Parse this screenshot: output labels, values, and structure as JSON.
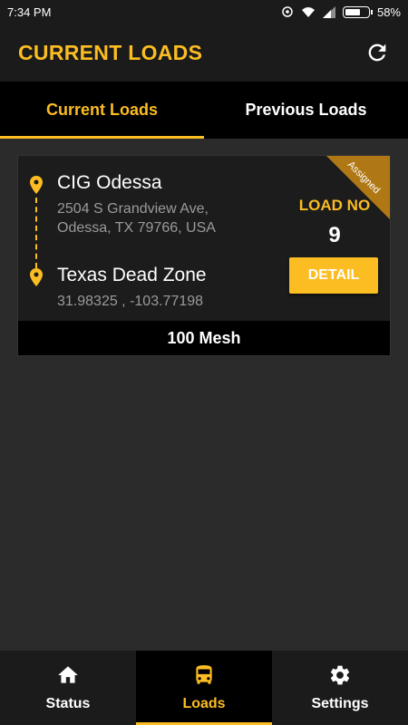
{
  "status_bar": {
    "time": "7:34 PM",
    "battery": "58%"
  },
  "header": {
    "title": "CURRENT LOADS",
    "refresh_icon": "refresh-icon"
  },
  "tabs": [
    {
      "label": "Current Loads",
      "active": true
    },
    {
      "label": "Previous Loads",
      "active": false
    }
  ],
  "load_card": {
    "ribbon": "Assigned",
    "origin": {
      "name": "CIG Odessa",
      "address_line1": "2504 S Grandview Ave,",
      "address_line2": "Odessa, TX 79766, USA"
    },
    "destination": {
      "name": "Texas Dead Zone",
      "coordinates": "31.98325 , -103.77198"
    },
    "load_no_label": "LOAD NO",
    "load_no": "9",
    "detail_label": "DETAIL",
    "product": "100 Mesh"
  },
  "bottom_nav": [
    {
      "label": "Status",
      "icon": "home-icon",
      "active": false
    },
    {
      "label": "Loads",
      "icon": "bus-icon",
      "active": true
    },
    {
      "label": "Settings",
      "icon": "gear-icon",
      "active": false
    }
  ],
  "colors": {
    "accent": "#fbbd22",
    "ribbon": "#b07815",
    "background": "#2a2b2a"
  }
}
